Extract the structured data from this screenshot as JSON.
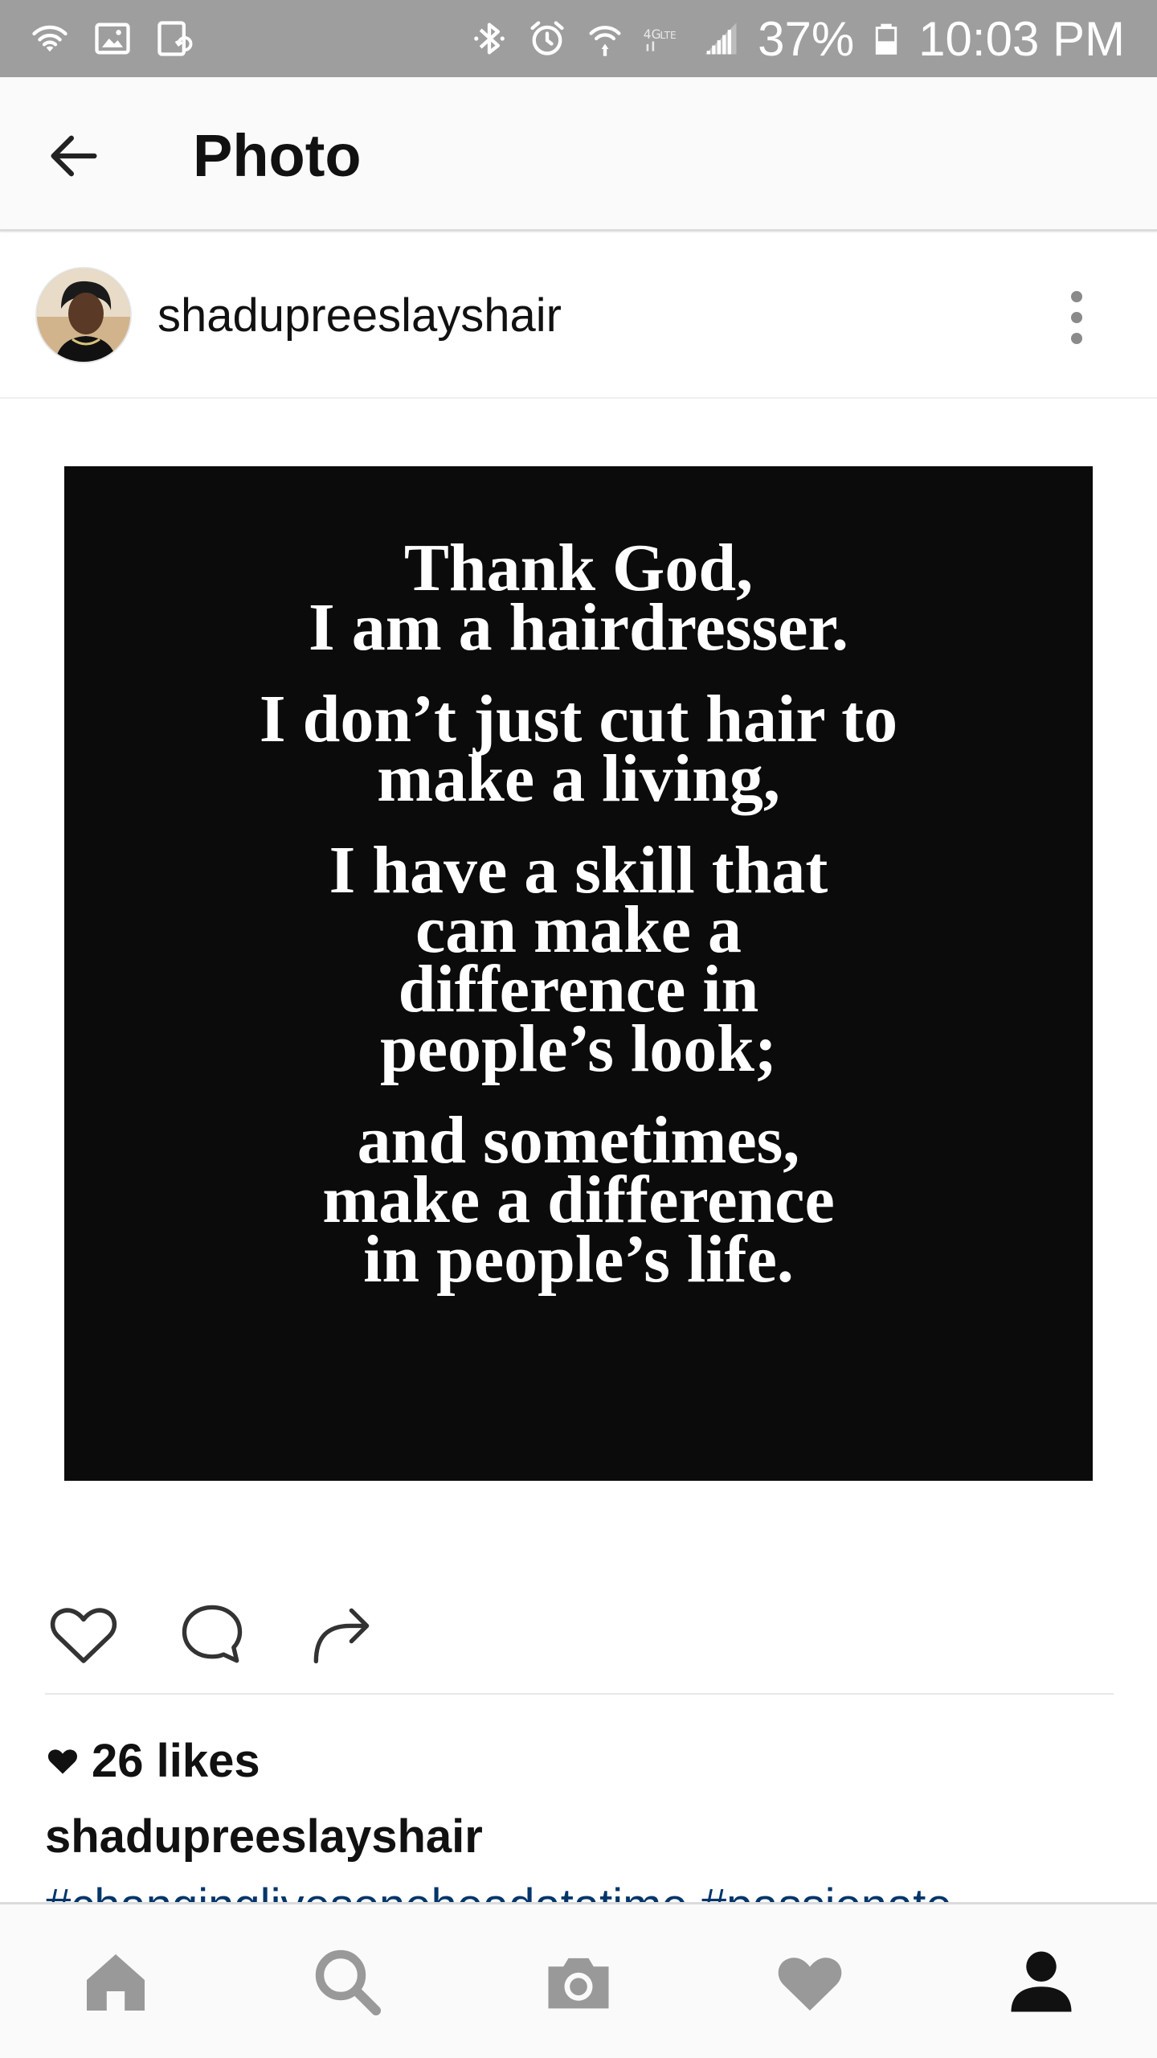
{
  "status_bar": {
    "battery_percent": "37%",
    "time": "10:03 PM",
    "left_icons": [
      "wifi-icon",
      "image-icon",
      "sync-icon"
    ],
    "right_icons": [
      "bluetooth-icon",
      "alarm-icon",
      "wifi-calling-icon",
      "lte-icon",
      "signal-icon",
      "battery-icon"
    ]
  },
  "app_bar": {
    "title": "Photo",
    "back_icon": "arrow-left-icon"
  },
  "post": {
    "username": "shadupreeslayshair",
    "more_icon": "more-vertical-icon",
    "image_quote": [
      [
        "Thank God,",
        "I am a hairdresser."
      ],
      [
        "I don’t just cut hair to",
        "make a living,"
      ],
      [
        "I have a skill that",
        "can make a",
        "difference in",
        "people’s look;"
      ],
      [
        "and sometimes,",
        "make a difference",
        "in people’s life."
      ]
    ],
    "likes": "26 likes",
    "caption_username": "shadupreeslayshair",
    "caption_text": "#changinglivesoneheadatatime #passionate"
  },
  "actions": {
    "like_icon": "heart-outline-icon",
    "comment_icon": "comment-icon",
    "share_icon": "share-arrow-icon"
  },
  "bottom_nav": {
    "items": [
      "home-icon",
      "search-icon",
      "camera-icon",
      "heart-icon",
      "profile-icon"
    ],
    "active": "profile-icon"
  },
  "colors": {
    "status_bar": "#9e9e9e",
    "image_bg": "#0b0b0b",
    "hashtag": "#003569",
    "nav_inactive": "#999999",
    "nav_active": "#111111"
  }
}
